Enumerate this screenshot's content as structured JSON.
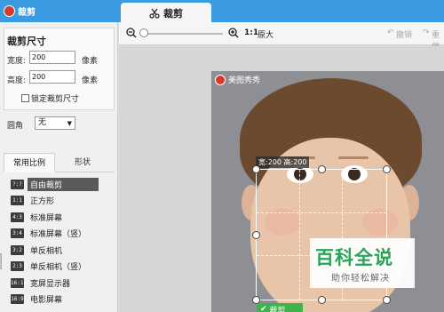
{
  "app": {
    "title": "裁剪"
  },
  "tab": {
    "label": "裁剪"
  },
  "toolbar": {
    "ratio_label": "1:1",
    "original_label": "原大",
    "undo_label": "撤销",
    "redo_label": "重做"
  },
  "crop_size": {
    "title": "裁剪尺寸",
    "width_label": "宽度:",
    "width_value": "200",
    "width_unit": "像素",
    "height_label": "高度:",
    "height_value": "200",
    "height_unit": "像素",
    "lock_label": "锁定裁剪尺寸",
    "lock_checked": false
  },
  "corner": {
    "label": "圆角",
    "value": "无"
  },
  "ratio_tabs": [
    {
      "label": "常用比例",
      "active": true
    },
    {
      "label": "形状",
      "active": false
    }
  ],
  "ratios": [
    {
      "badge": "?:?",
      "label": "自由裁剪",
      "selected": true
    },
    {
      "badge": "1:1",
      "label": "正方形",
      "selected": false
    },
    {
      "badge": "4:3",
      "label": "标准屏幕",
      "selected": false
    },
    {
      "badge": "3:4",
      "label": "标准屏幕（竖）",
      "selected": false
    },
    {
      "badge": "3:2",
      "label": "单反相机",
      "selected": false
    },
    {
      "badge": "2:3",
      "label": "单反相机（竖）",
      "selected": false
    },
    {
      "badge": "16:10",
      "label": "宽屏显示器",
      "selected": false
    },
    {
      "badge": "16:9",
      "label": "电影屏幕",
      "selected": false
    }
  ],
  "canvas": {
    "watermark": "美图秀秀",
    "crop_dims": "宽:200 高:200",
    "crop_button": "裁剪"
  },
  "brand": {
    "main": "百科全说",
    "sub": "助你轻松解决"
  },
  "colors": {
    "topbar": "#3a9be0",
    "accent_green": "#3bb54a",
    "brand_green": "#2aa35a"
  }
}
